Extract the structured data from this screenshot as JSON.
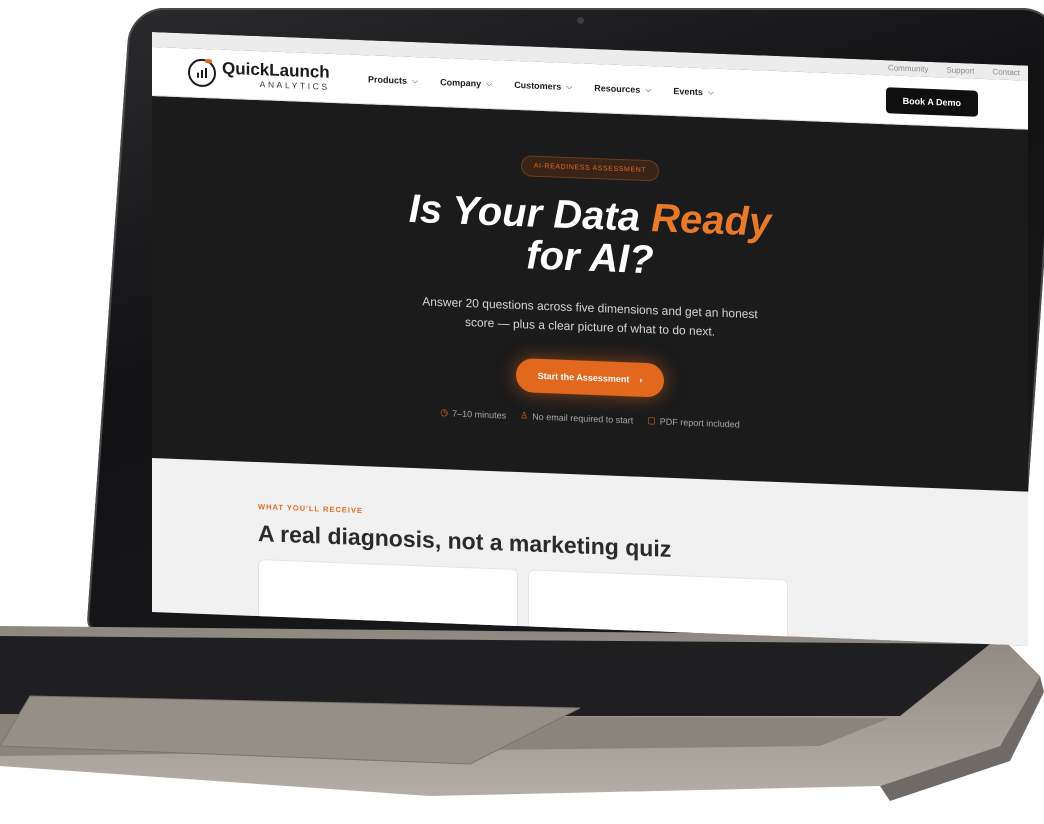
{
  "utility": [
    "Community",
    "Support",
    "Contact"
  ],
  "brand": {
    "name": "QuickLaunch",
    "sub": "ANALYTICS",
    "accent": "#e2681e"
  },
  "nav": [
    {
      "label": "Products"
    },
    {
      "label": "Company"
    },
    {
      "label": "Customers"
    },
    {
      "label": "Resources"
    },
    {
      "label": "Events"
    }
  ],
  "header": {
    "cta": "Book A Demo"
  },
  "hero": {
    "eyebrow": "AI-READINESS ASSESSMENT",
    "title_a": "Is Your Data",
    "title_accent": "Ready",
    "title_b": "for AI?",
    "subtitle": "Answer 20 questions across five dimensions and get an honest score — plus a clear picture of what to do next.",
    "cta": "Start the Assessment",
    "meta": [
      {
        "icon": "clock-icon",
        "text": "7–10 minutes"
      },
      {
        "icon": "user-icon",
        "text": "No email required to start"
      },
      {
        "icon": "document-icon",
        "text": "PDF report included"
      }
    ]
  },
  "section": {
    "eyebrow": "WHAT YOU'LL RECEIVE",
    "title": "A real diagnosis, not a marketing quiz"
  }
}
